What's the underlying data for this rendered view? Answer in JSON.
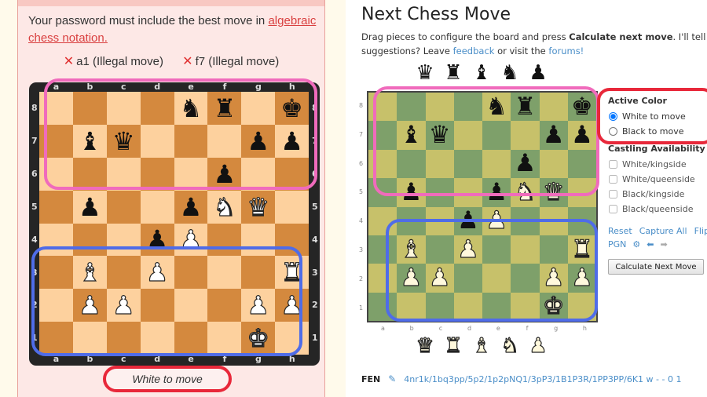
{
  "left": {
    "rule_text": "Your password must include the best move in ",
    "rule_link": "algebraic chess notation.",
    "illegal_attempts": [
      {
        "icon": "x-icon",
        "glyph": "✕",
        "text": "a1 (Illegal move)"
      },
      {
        "icon": "x-icon",
        "glyph": "✕",
        "text": "f7 (Illegal move)"
      }
    ],
    "turn_label": "White to move",
    "colors": {
      "light_square": "#fdd19e",
      "dark_square": "#d4893e",
      "frame": "#252525"
    }
  },
  "board": {
    "files": [
      "a",
      "b",
      "c",
      "d",
      "e",
      "f",
      "g",
      "h"
    ],
    "ranks": [
      "8",
      "7",
      "6",
      "5",
      "4",
      "3",
      "2",
      "1"
    ],
    "rows": [
      [
        "",
        "",
        "",
        "",
        "n",
        "r",
        "",
        "k"
      ],
      [
        "",
        "b",
        "q",
        "",
        "",
        "",
        "p",
        "p"
      ],
      [
        "",
        "",
        "",
        "",
        "",
        "p",
        "",
        ""
      ],
      [
        "",
        "p",
        "",
        "",
        "p",
        "N",
        "Q",
        ""
      ],
      [
        "",
        "",
        "",
        "p",
        "P",
        "",
        "",
        ""
      ],
      [
        "",
        "B",
        "",
        "P",
        "",
        "",
        "",
        "R"
      ],
      [
        "",
        "P",
        "P",
        "",
        "",
        "",
        "P",
        "P"
      ],
      [
        "",
        "",
        "",
        "",
        "",
        "",
        "K",
        ""
      ]
    ]
  },
  "right": {
    "title": "Next Chess Move",
    "intro_part1": "Drag pieces to configure the board and press ",
    "intro_bold": "Calculate next move",
    "intro_part2": ". I'll tell you what t",
    "intro_line2_a": "suggestions? Leave ",
    "feedback_link": "feedback",
    "intro_line2_b": " or visit the ",
    "forums_link": "forums!",
    "black_spare_pieces": [
      "q",
      "r",
      "b",
      "n",
      "p"
    ],
    "white_spare_pieces": [
      "Q",
      "R",
      "B",
      "N",
      "P"
    ],
    "active_color": {
      "heading": "Active Color",
      "options": [
        {
          "label": "White to move",
          "checked": true
        },
        {
          "label": "Black to move",
          "checked": false
        }
      ]
    },
    "castling": {
      "heading": "Castling Availability",
      "options": [
        {
          "label": "White/kingside",
          "checked": false
        },
        {
          "label": "White/queenside",
          "checked": false
        },
        {
          "label": "Black/kingside",
          "checked": false
        },
        {
          "label": "Black/queenside",
          "checked": false
        }
      ]
    },
    "links": {
      "reset": "Reset",
      "capture_all": "Capture All",
      "flip": "Flip",
      "pgn": "PGN"
    },
    "icons": {
      "settings": "⚙",
      "back": "⬅",
      "forward": "➡"
    },
    "calculate_button": "Calculate Next Move",
    "fen_label": "FEN",
    "fen_edit_icon": "✎",
    "fen_value": "4nr1k/1bq3pp/5p2/1p2pNQ1/3pP3/1B1P3R/1PP3PP/6K1 w - - 0 1",
    "colors": {
      "light_square": "#c7c16a",
      "dark_square": "#7ea06a",
      "link": "#4a8ec8"
    }
  },
  "annotations": {
    "pink": "#f06bbc",
    "blue": "#4f6ce8",
    "red": "#e8283a"
  }
}
